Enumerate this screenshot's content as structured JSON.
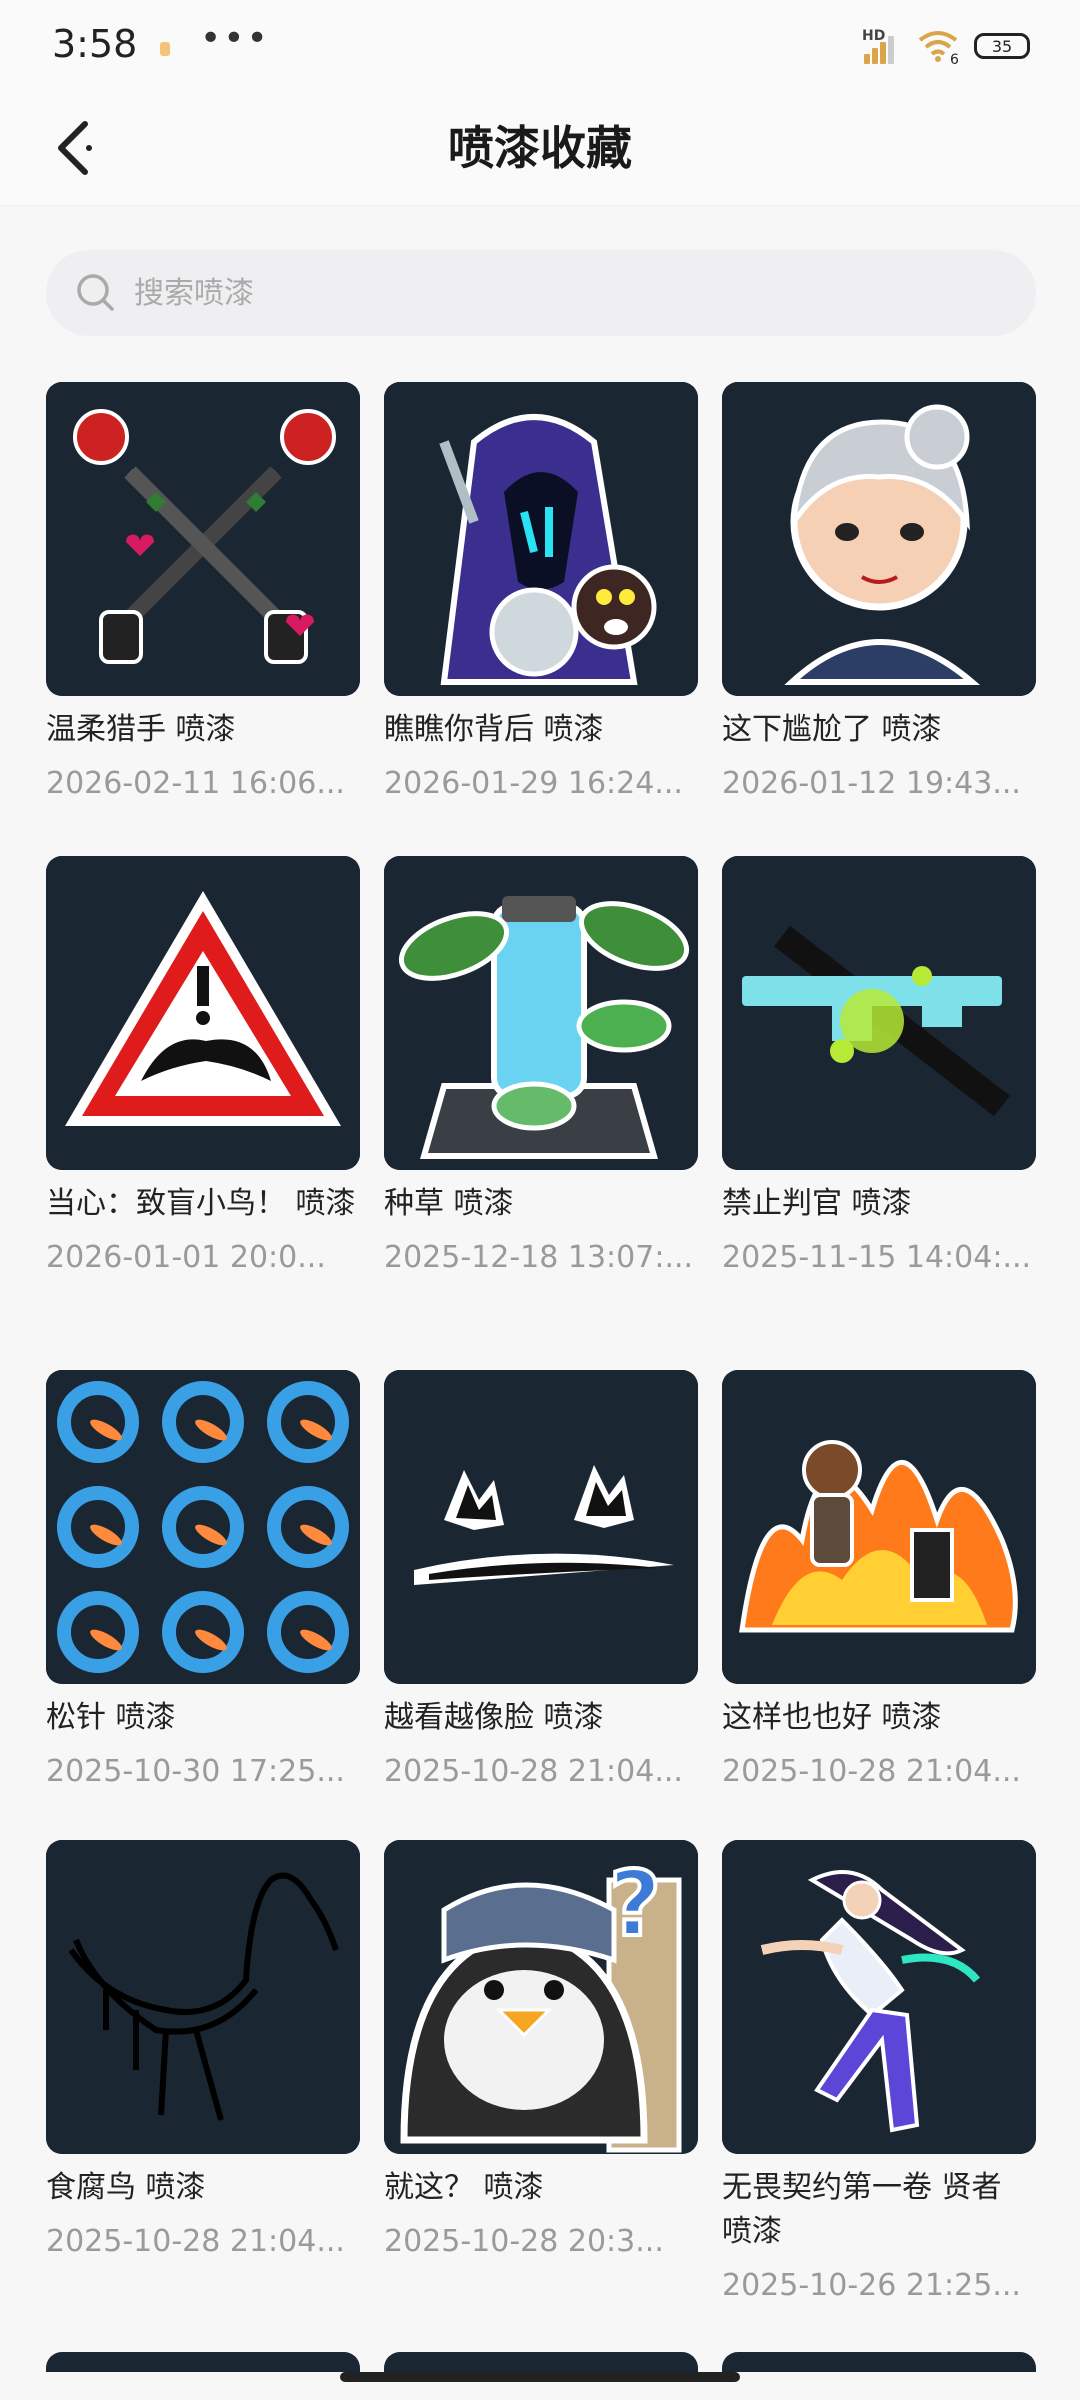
{
  "status_bar": {
    "time": "3:58",
    "more": "•••",
    "network": "HD",
    "wifi_badge": "6",
    "battery": "35"
  },
  "header": {
    "title": "喷漆收藏"
  },
  "search": {
    "placeholder": "搜索喷漆"
  },
  "items": [
    {
      "title": "温柔猎手 喷漆",
      "date": "2026-02-11 16:06...",
      "icon": "roses-revolvers-spray"
    },
    {
      "title": "瞧瞧你背后 喷漆",
      "date": "2026-01-29 16:24...",
      "icon": "hooded-figure-spray"
    },
    {
      "title": "这下尴尬了 喷漆",
      "date": "2026-01-12 19:43...",
      "icon": "chibi-agent-spray"
    },
    {
      "title": "当心：致盲小鸟！ 喷漆",
      "date": "2026-01-01 20:0...",
      "icon": "warning-sign-spray"
    },
    {
      "title": "种草 喷漆",
      "date": "2025-12-18 13:07:...",
      "icon": "plant-canister-spray"
    },
    {
      "title": "禁止判官 喷漆",
      "date": "2025-11-15 14:04:...",
      "icon": "no-shotgun-spray"
    },
    {
      "title": "松针 喷漆",
      "date": "2025-10-30 17:25...",
      "icon": "koi-waves-spray"
    },
    {
      "title": "越看越像脸 喷漆",
      "date": "2025-10-28 21:04...",
      "icon": "face-cracks-spray"
    },
    {
      "title": "这样也也好 喷漆",
      "date": "2025-10-28 21:04...",
      "icon": "fire-agent-spray"
    },
    {
      "title": "食腐鸟 喷漆",
      "date": "2025-10-28 21:04...",
      "icon": "ibis-sketch-spray"
    },
    {
      "title": "就这？ 喷漆",
      "date": "2025-10-28 20:3...",
      "icon": "penguin-question-spray"
    },
    {
      "title": "无畏契约第一卷 贤者 喷漆",
      "date": "2025-10-26 21:25...",
      "icon": "sage-agent-spray"
    }
  ]
}
